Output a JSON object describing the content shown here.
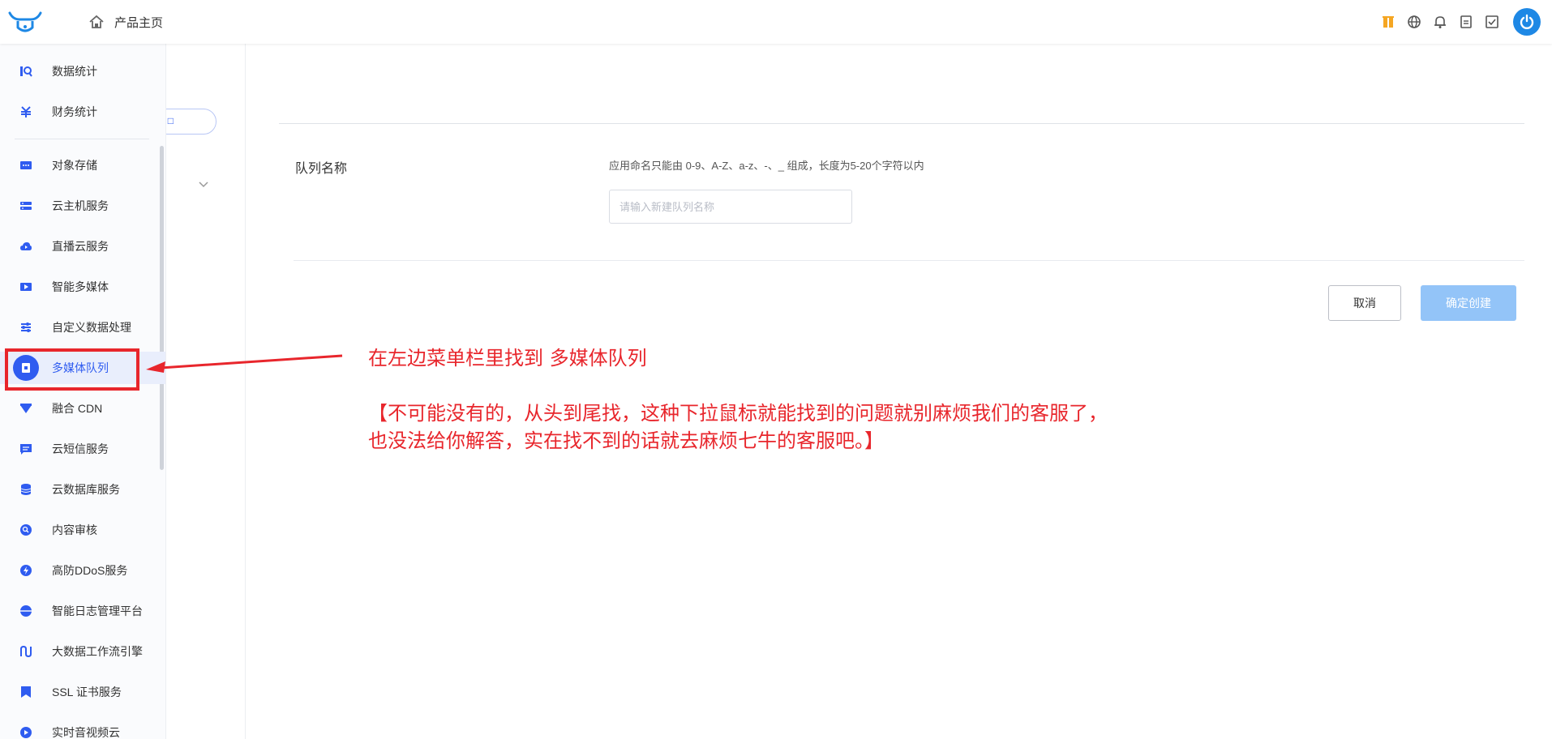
{
  "header": {
    "home_label": "产品主页",
    "icons": [
      "logo-bull-icon",
      "home-icon",
      "gift-icon",
      "globe-icon",
      "bell-icon",
      "document-icon",
      "task-icon",
      "power-icon"
    ],
    "accent": "#2f5cf0",
    "gift_color": "#f5a623"
  },
  "sidebar": {
    "items": [
      {
        "label": "数据统计",
        "icon": "data-stats-icon"
      },
      {
        "label": "财务统计",
        "icon": "finance-icon"
      },
      {
        "label": "对象存储",
        "icon": "object-storage-icon"
      },
      {
        "label": "云主机服务",
        "icon": "cloud-host-icon"
      },
      {
        "label": "直播云服务",
        "icon": "live-cloud-icon"
      },
      {
        "label": "智能多媒体",
        "icon": "multimedia-icon"
      },
      {
        "label": "自定义数据处理",
        "icon": "custom-processing-icon"
      },
      {
        "label": "多媒体队列",
        "icon": "media-queue-icon",
        "active": true
      },
      {
        "label": "融合 CDN",
        "icon": "cdn-icon"
      },
      {
        "label": "云短信服务",
        "icon": "sms-icon"
      },
      {
        "label": "云数据库服务",
        "icon": "database-icon"
      },
      {
        "label": "内容审核",
        "icon": "content-review-icon"
      },
      {
        "label": "高防DDoS服务",
        "icon": "ddos-icon"
      },
      {
        "label": "智能日志管理平台",
        "icon": "log-platform-icon"
      },
      {
        "label": "大数据工作流引擎",
        "icon": "workflow-icon"
      },
      {
        "label": "SSL 证书服务",
        "icon": "ssl-icon"
      },
      {
        "label": "实时音视频云",
        "icon": "rtc-icon"
      }
    ]
  },
  "form": {
    "field_label": "队列名称",
    "hint": "应用命名只能由 0-9、A-Z、a-z、-、_ 组成，长度为5-20个字符以内",
    "input_value": "",
    "input_placeholder": "请输入新建队列名称",
    "cancel_label": "取消",
    "confirm_label": "确定创建",
    "confirm_color": "#93c4f8"
  },
  "annotation": {
    "line1": "在左边菜单栏里找到  多媒体队列",
    "line2": "【不可能没有的，从头到尾找，这种下拉鼠标就能找到的问题就别麻烦我们的客服了，",
    "line3": "也没法给你解答，实在找不到的话就去麻烦七牛的客服吧。】",
    "color": "#e8262c"
  }
}
